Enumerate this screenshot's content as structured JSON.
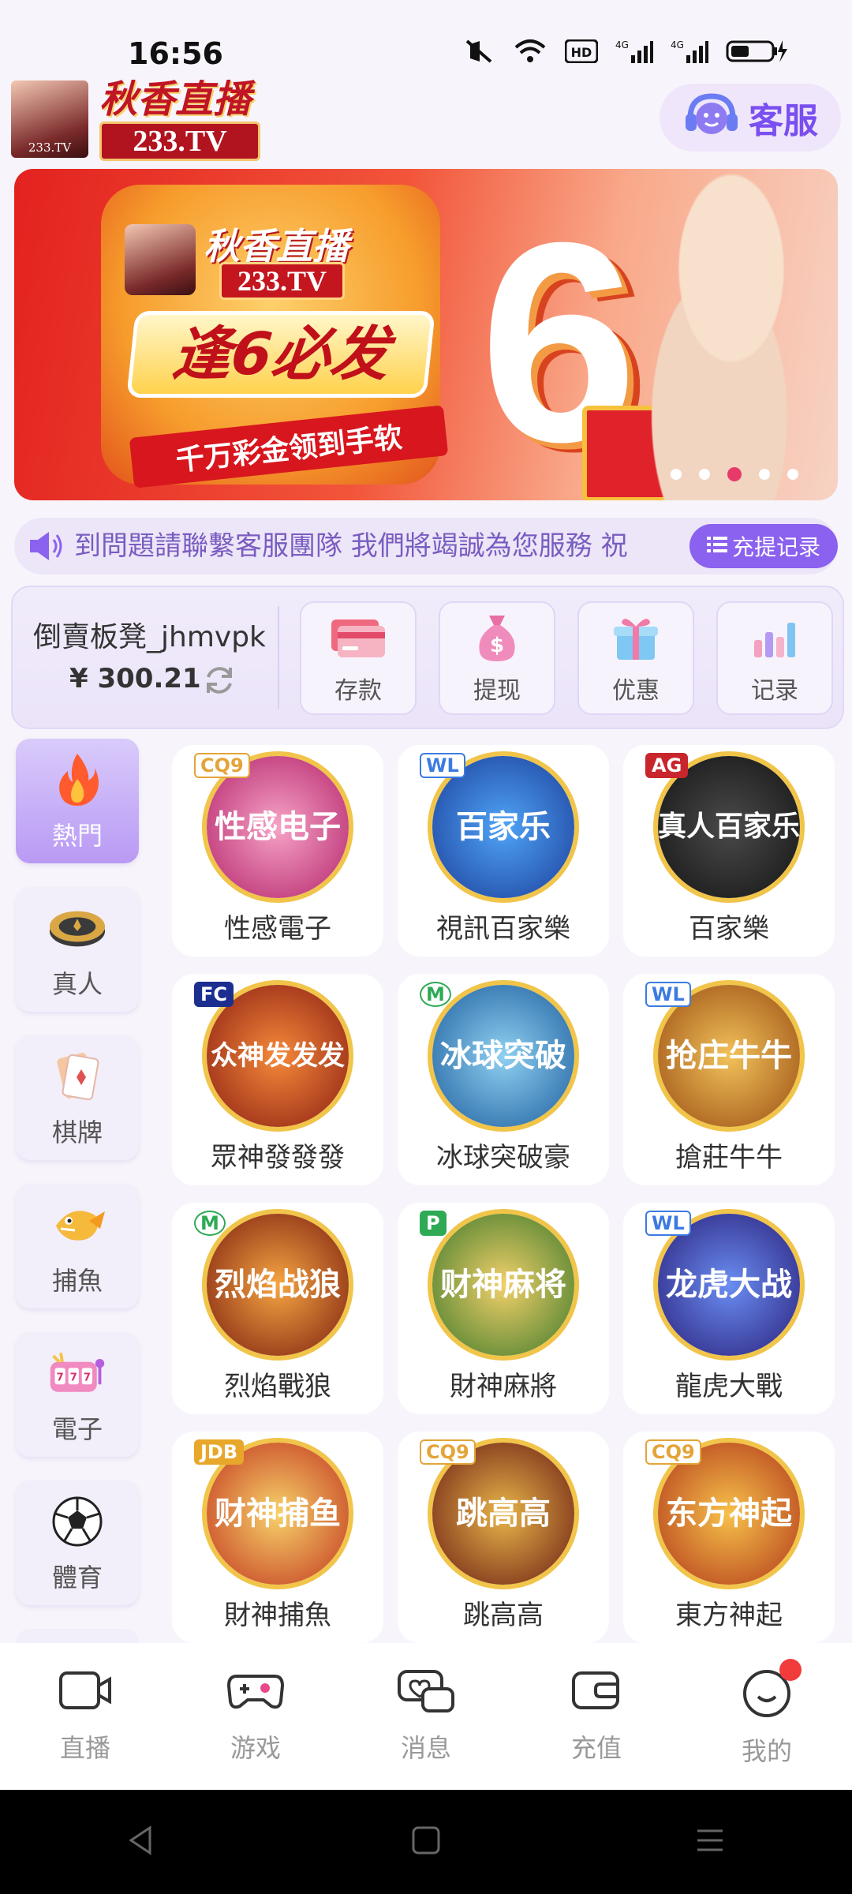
{
  "status": {
    "time": "16:56",
    "network_1": "4G",
    "network_2": "4G",
    "hd_badge": "HD"
  },
  "header": {
    "logo_cn": "秋香直播",
    "logo_tv": "233.TV",
    "logo_small": "233.TV",
    "service_label": "客服"
  },
  "banner": {
    "brand_cn": "秋香直播",
    "brand_tv": "233.TV",
    "logo_small": "233.TV",
    "headline": "逢6必发",
    "subline": "千万彩金领到手软",
    "big_number": "6",
    "slides_total": 5,
    "active_slide": 2
  },
  "notice": {
    "text": "到問題請聯繫客服團隊 我們將竭誠為您服務 祝",
    "record_label": "充提记录"
  },
  "wallet": {
    "username": "倒賣板凳_jhmvpk",
    "balance": "¥ 300.21",
    "actions": [
      {
        "label": "存款",
        "icon": "card-icon"
      },
      {
        "label": "提现",
        "icon": "money-bag-icon"
      },
      {
        "label": "优惠",
        "icon": "gift-icon"
      },
      {
        "label": "记录",
        "icon": "bar-chart-icon"
      }
    ]
  },
  "categories": [
    {
      "label": "熱門",
      "icon": "flame-icon",
      "active": true
    },
    {
      "label": "真人",
      "icon": "chip-icon"
    },
    {
      "label": "棋牌",
      "icon": "cards-icon"
    },
    {
      "label": "捕魚",
      "icon": "fish-icon"
    },
    {
      "label": "電子",
      "icon": "slot-icon"
    },
    {
      "label": "體育",
      "icon": "soccer-ball-icon"
    }
  ],
  "games": [
    {
      "name": "性感電子",
      "badge": "CQ9",
      "art": "性感电子"
    },
    {
      "name": "視訊百家樂",
      "badge": "WL",
      "art": "百家乐"
    },
    {
      "name": "百家樂",
      "badge": "AG",
      "art": "真人百家乐"
    },
    {
      "name": "眾神發發發",
      "badge": "FC",
      "art": "众神发发发"
    },
    {
      "name": "冰球突破豪",
      "badge": "M",
      "art": "冰球突破"
    },
    {
      "name": "搶莊牛牛",
      "badge": "WL",
      "art": "抢庄牛牛"
    },
    {
      "name": "烈焰戰狼",
      "badge": "M",
      "art": "烈焰战狼"
    },
    {
      "name": "財神麻將",
      "badge": "P",
      "art": "财神麻将"
    },
    {
      "name": "龍虎大戰",
      "badge": "WL",
      "art": "龙虎大战"
    },
    {
      "name": "財神捕魚",
      "badge": "JDB",
      "art": "财神捕鱼"
    },
    {
      "name": "跳高高",
      "badge": "CQ9",
      "art": "跳高高"
    },
    {
      "name": "東方神起",
      "badge": "CQ9",
      "art": "东方神起"
    }
  ],
  "bottom_nav": [
    {
      "label": "直播",
      "icon": "camera-icon"
    },
    {
      "label": "游戏",
      "icon": "gamepad-icon"
    },
    {
      "label": "消息",
      "icon": "chat-icon"
    },
    {
      "label": "充值",
      "icon": "wallet-icon"
    },
    {
      "label": "我的",
      "icon": "smiley-icon"
    }
  ],
  "colors": {
    "accent": "#8b61ef",
    "brand_red": "#c01525",
    "nav_inactive": "#999999",
    "badge_red": "#f23b3b"
  }
}
